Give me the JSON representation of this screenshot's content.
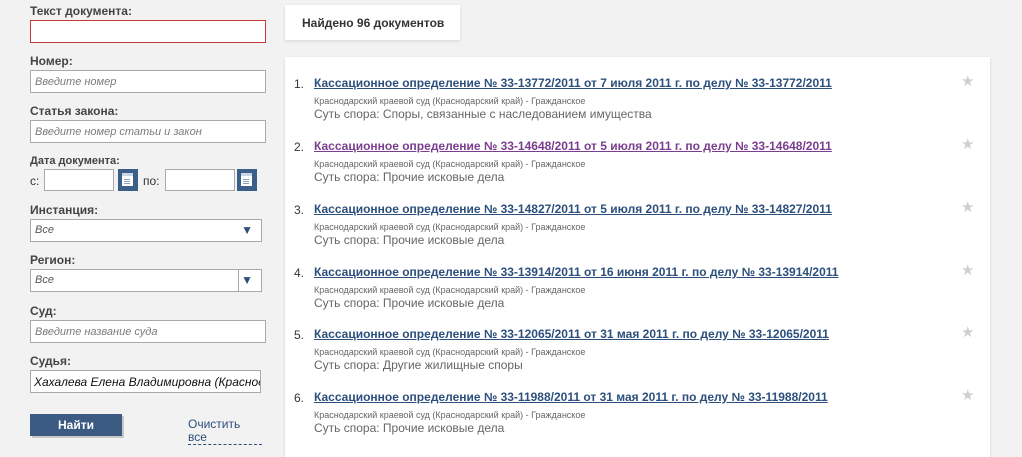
{
  "filters": {
    "doc_text_label": "Текст документа:",
    "doc_text_value": "",
    "number_label": "Номер:",
    "number_placeholder": "Введите номер",
    "article_label": "Статья закона:",
    "article_placeholder": "Введите номер статьи и закон",
    "date_label": "Дата документа:",
    "date_from_label": "с:",
    "date_to_label": "по:",
    "instance_label": "Инстанция:",
    "instance_value": "Все",
    "region_label": "Регион:",
    "region_value": "Все",
    "court_label": "Суд:",
    "court_placeholder": "Введите название суда",
    "judge_label": "Судья:",
    "judge_value": "Хахалева Елена Владимировна (Краснодарский краевой суд)",
    "find_button": "Найти",
    "clear_link": "Очистить все"
  },
  "results": {
    "found_text": "Найдено 96 документов",
    "items": [
      {
        "num": "1.",
        "title": "Кассационное определение № 33-13772/2011 от 7 июля 2011 г. по делу № 33-13772/2011",
        "court": "Краснодарский краевой суд (Краснодарский край) - Гражданское",
        "dispute": "Суть спора: Споры, связанные с наследованием имущества",
        "visited": false
      },
      {
        "num": "2.",
        "title": "Кассационное определение № 33-14648/2011 от 5 июля 2011 г. по делу № 33-14648/2011",
        "court": "Краснодарский краевой суд (Краснодарский край) - Гражданское",
        "dispute": "Суть спора: Прочие исковые дела",
        "visited": true
      },
      {
        "num": "3.",
        "title": "Кассационное определение № 33-14827/2011 от 5 июля 2011 г. по делу № 33-14827/2011",
        "court": "Краснодарский краевой суд (Краснодарский край) - Гражданское",
        "dispute": "Суть спора: Прочие исковые дела",
        "visited": false
      },
      {
        "num": "4.",
        "title": "Кассационное определение № 33-13914/2011 от 16 июня 2011 г. по делу № 33-13914/2011",
        "court": "Краснодарский краевой суд (Краснодарский край) - Гражданское",
        "dispute": "Суть спора: Прочие исковые дела",
        "visited": false
      },
      {
        "num": "5.",
        "title": "Кассационное определение № 33-12065/2011 от 31 мая 2011 г. по делу № 33-12065/2011",
        "court": "Краснодарский краевой суд (Краснодарский край) - Гражданское",
        "dispute": "Суть спора: Другие жилищные споры",
        "visited": false
      },
      {
        "num": "6.",
        "title": "Кассационное определение № 33-11988/2011 от 31 мая 2011 г. по делу № 33-11988/2011",
        "court": "Краснодарский краевой суд (Краснодарский край) - Гражданское",
        "dispute": "Суть спора: Прочие исковые дела",
        "visited": false
      }
    ]
  },
  "icons": {
    "calendar": "calendar-icon",
    "dropdown": "chevron-down-icon",
    "favorite": "star-icon"
  },
  "colors": {
    "link": "#2c4f7c",
    "visited_link": "#7b3d8f",
    "button": "#3b5b82",
    "required_border": "#c23a3a"
  }
}
